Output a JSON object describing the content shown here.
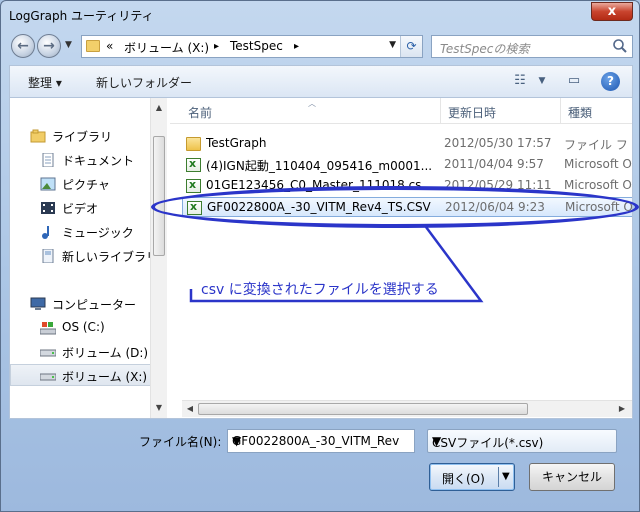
{
  "window": {
    "title": "LogGraph ユーティリティ",
    "close_glyph": "x"
  },
  "address_bar": {
    "overflow": "«",
    "crumbs": [
      "ボリューム (X:)",
      "TestSpec"
    ],
    "separator": "▸",
    "search_placeholder": "TestSpecの検索"
  },
  "toolbar": {
    "organize": "整理 ▾",
    "new_folder": "新しいフォルダー"
  },
  "nav": {
    "libraries": "ライブラリ",
    "documents": "ドキュメント",
    "pictures": "ピクチャ",
    "videos": "ビデオ",
    "music": "ミュージック",
    "new_library": "新しいライブラリ",
    "computer": "コンピューター",
    "drive_c": "OS (C:)",
    "drive_d": "ボリューム (D:)",
    "drive_x": "ボリューム (X:)"
  },
  "columns": {
    "name": "名前",
    "modified": "更新日時",
    "type": "種類"
  },
  "files": [
    {
      "name": "TestGraph",
      "date": "2012/05/30 17:57",
      "type": "ファイル フ",
      "icon": "folder-icon"
    },
    {
      "name": "(4)IGN起動_110404_095416_m0001...",
      "date": "2011/04/04 9:57",
      "type": "Microsoft O",
      "icon": "excel-icon"
    },
    {
      "name": "01GE123456_C0_Master_111018.cs",
      "date": "2012/05/29 11:11",
      "type": "Microsoft O",
      "icon": "excel-icon"
    },
    {
      "name": "GF0022800A_-30_VITM_Rev4_TS.CSV",
      "date": "2012/06/04 9:23",
      "type": "Microsoft O",
      "icon": "excel-icon"
    }
  ],
  "annotation": {
    "text": "csv に変換されたファイルを選択する",
    "color": "#2b35c9"
  },
  "bottom": {
    "filename_label": "ファイル名(N):",
    "filename_value": "GF0022800A_-30_VITM_Rev",
    "filetype_value": "CSVファイル(*.csv)",
    "open_label": "開く(O)",
    "cancel_label": "キャンセル"
  }
}
